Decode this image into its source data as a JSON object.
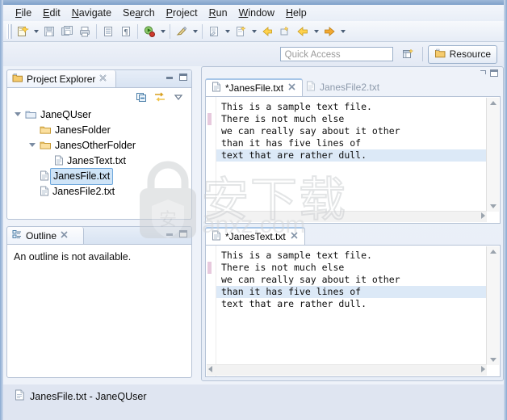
{
  "app": {
    "perspective": "Resource"
  },
  "menubar": {
    "items": [
      {
        "label": "File",
        "mnemonic": "F"
      },
      {
        "label": "Edit",
        "mnemonic": "E"
      },
      {
        "label": "Navigate",
        "mnemonic": "N"
      },
      {
        "label": "Search",
        "mnemonic": "a"
      },
      {
        "label": "Project",
        "mnemonic": "P"
      },
      {
        "label": "Run",
        "mnemonic": "R"
      },
      {
        "label": "Window",
        "mnemonic": "W"
      },
      {
        "label": "Help",
        "mnemonic": "H"
      }
    ]
  },
  "toolbar": {
    "icons": [
      "new-wizard-icon",
      "save-icon",
      "save-all-icon",
      "print-icon",
      "toggle-markers-icon",
      "toggle-whitespace-icon",
      "run-debug-icon",
      "run-icon",
      "external-tools-icon",
      "new-java-class-icon",
      "previous-annotation-icon",
      "next-annotation-icon",
      "back-icon",
      "forward-icon"
    ]
  },
  "quick_access": {
    "placeholder": "Quick Access",
    "value": "",
    "open_perspective_icon": "open-perspective-icon",
    "perspective_button": "Resource",
    "perspective_icon": "resource-perspective-icon"
  },
  "project_explorer": {
    "title": "Project Explorer",
    "icon": "project-explorer-icon",
    "close_icon": "close-icon",
    "minimize_icon": "minimize-icon",
    "maximize_icon": "maximize-icon",
    "toolbar_icons": [
      "collapse-all-icon",
      "link-with-editor-icon",
      "view-menu-icon"
    ],
    "tree": [
      {
        "label": "JaneQUser",
        "type": "project",
        "depth": 0,
        "expanded": true,
        "selected": false
      },
      {
        "label": "JanesFolder",
        "type": "folder",
        "depth": 1,
        "expanded": null,
        "selected": false
      },
      {
        "label": "JanesOtherFolder",
        "type": "folder",
        "depth": 1,
        "expanded": true,
        "selected": false
      },
      {
        "label": "JanesText.txt",
        "type": "file",
        "depth": 2,
        "expanded": null,
        "selected": false
      },
      {
        "label": "JanesFile.txt",
        "type": "file",
        "depth": 1,
        "expanded": null,
        "selected": true
      },
      {
        "label": "JanesFile2.txt",
        "type": "file",
        "depth": 1,
        "expanded": null,
        "selected": false
      }
    ]
  },
  "outline": {
    "title": "Outline",
    "icon": "outline-icon",
    "close_icon": "close-icon",
    "minimize_icon": "minimize-icon",
    "maximize_icon": "maximize-icon",
    "message": "An outline is not available."
  },
  "editor_area": {
    "restore_icon": "restore-icon",
    "maximize_icon": "maximize-icon",
    "editors": [
      {
        "tabs": [
          {
            "label": "*JanesFile.txt",
            "active": true,
            "dirty": true,
            "icon": "text-file-icon",
            "close_icon": "close-icon"
          },
          {
            "label": "JanesFile2.txt",
            "active": false,
            "dirty": false,
            "icon": "text-file-icon",
            "close_icon": null
          }
        ],
        "lines": [
          "This is a sample text file.",
          "There is not much else",
          "we can really say about it other",
          "than it has five lines of",
          "text that are rather dull."
        ],
        "current_line": 5,
        "changed_line": 2
      },
      {
        "tabs": [
          {
            "label": "*JanesText.txt",
            "active": true,
            "dirty": true,
            "icon": "text-file-icon",
            "close_icon": "close-icon"
          }
        ],
        "lines": [
          "This is a sample text file.",
          "There is not much else",
          "we can really say about it other",
          "than it has five lines of",
          "text that are rather dull."
        ],
        "current_line": 4,
        "changed_line": 2
      }
    ]
  },
  "statusbar": {
    "icon": "text-file-icon",
    "text": "JanesFile.txt - JaneQUser"
  },
  "watermark": {
    "chinese": "安下载",
    "url": "anxz.com",
    "icon": "lock-shield-icon"
  },
  "colors": {
    "selection": "#cfe4f7",
    "current_line": "#dce9f7",
    "chrome": "#dfe5f1",
    "tab_active_border": "#a7c6e8"
  }
}
